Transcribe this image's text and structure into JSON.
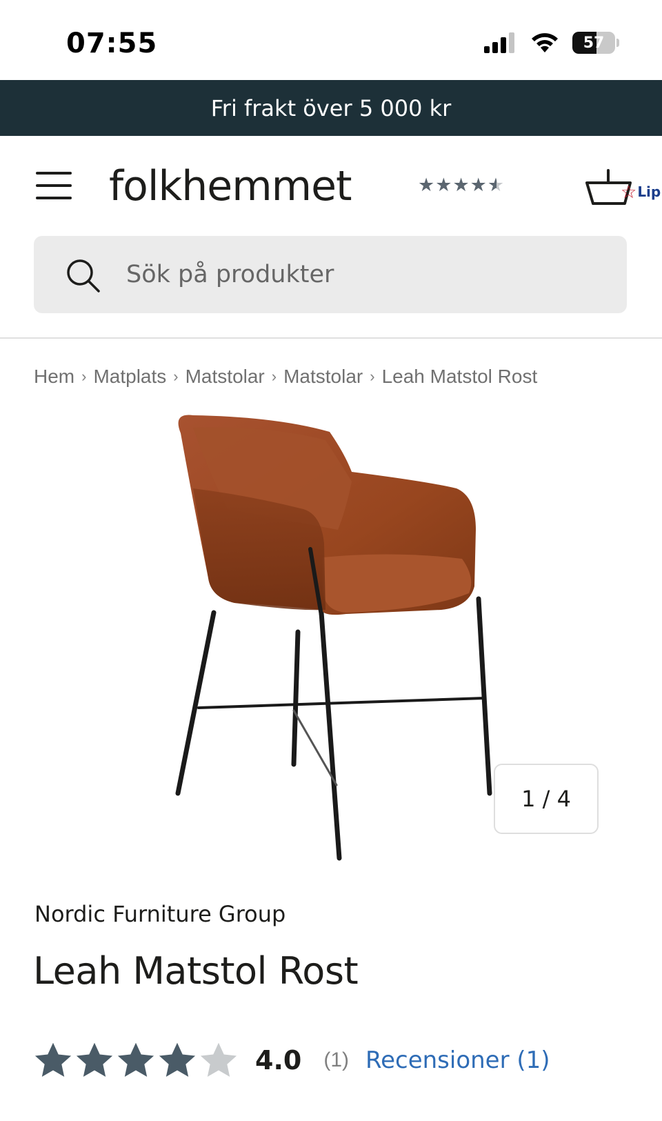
{
  "status_bar": {
    "time": "07:55",
    "battery_level": "57",
    "icons": [
      "signal-icon",
      "wifi-icon",
      "battery-icon"
    ]
  },
  "promo": {
    "text": "Fri frakt över 5 000 kr"
  },
  "header": {
    "logo": "folkhemmet",
    "trust_rating_stars": 4.5,
    "badge_text": "Lip",
    "icons": [
      "menu-icon",
      "cart-icon",
      "star-badge-icon"
    ]
  },
  "search": {
    "placeholder": "Sök på produkter"
  },
  "breadcrumb": [
    "Hem",
    "Matplats",
    "Matstolar",
    "Matstolar",
    "Leah Matstol Rost"
  ],
  "gallery": {
    "counter": "1 / 4"
  },
  "product": {
    "brand": "Nordic Furniture Group",
    "title": "Leah Matstol Rost",
    "rating_value": "4.0",
    "rating_stars": 4,
    "review_count": "(1)",
    "reviews_link": "Recensioner (1)"
  },
  "colors": {
    "promo_bg": "#1d3038",
    "link": "#2e6cb6",
    "star_filled": "#4a5b67",
    "star_empty": "#c8cbcd",
    "chair_velvet": "#9e4a26"
  }
}
